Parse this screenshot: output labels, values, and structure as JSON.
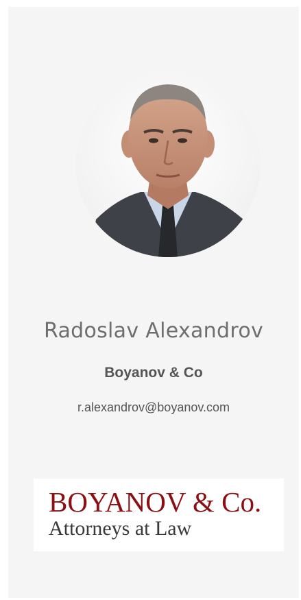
{
  "profile": {
    "name": "Radoslav Alexandrov",
    "company": "Boyanov & Co",
    "email": "r.alexandrov@boyanov.com"
  },
  "logo": {
    "line1": "BOYANOV & Co.",
    "line2": "Attorneys at Law",
    "brand_color": "#8a1014"
  }
}
